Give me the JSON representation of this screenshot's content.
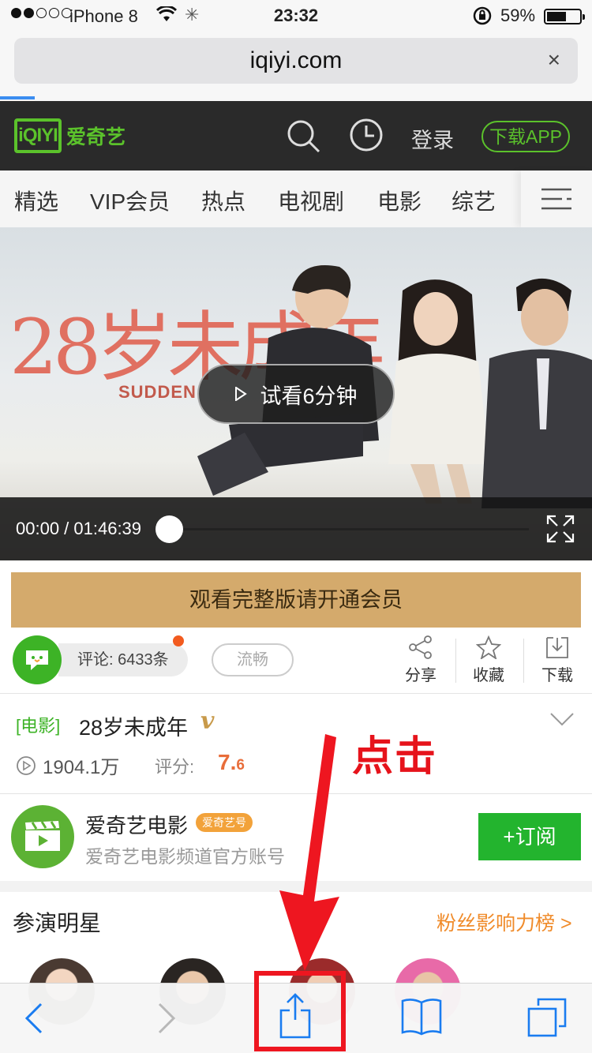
{
  "status_bar": {
    "carrier": "iPhone 8",
    "time": "23:32",
    "battery": "59%",
    "battery_level": 0.59
  },
  "url_bar": {
    "url": "iqiyi.com",
    "clear": "×"
  },
  "header": {
    "logo_mark": "iQIYI",
    "logo_name": "爱奇艺",
    "login": "登录",
    "download": "下载APP"
  },
  "nav": {
    "items": [
      "精选",
      "VIP会员",
      "热点",
      "电视剧",
      "电影",
      "综艺"
    ]
  },
  "video": {
    "poster_title": "28岁未成年",
    "poster_subtitle": "SUDDEN",
    "trial_button": "试看6分钟",
    "timecode": "00:00 / 01:46:39"
  },
  "vip_banner": "观看完整版请开通会员",
  "actions": {
    "comments": "评论: 6433条",
    "quality": "流畅",
    "share": "分享",
    "favorite": "收藏",
    "download": "下载"
  },
  "movie": {
    "tag": "[电影]",
    "title": "28岁未成年",
    "vip_mark": "v",
    "plays": "1904.1万",
    "score_label": "评分:",
    "score_main": "7.",
    "score_decimal": "6"
  },
  "annotation": "点击",
  "channel": {
    "name": "爱奇艺电影",
    "badge": "爱奇艺号",
    "description": "爱奇艺电影频道官方账号",
    "subscribe": "+订阅"
  },
  "cast": {
    "title": "参演明星",
    "fans_link": "粉丝影响力榜 >"
  },
  "colors": {
    "brand_green": "#5bc22b",
    "vip_gold": "#d4aa6c",
    "subscribe_green": "#23b42e",
    "annotation_red": "#e6131b",
    "ios_blue": "#1a7cf0"
  }
}
